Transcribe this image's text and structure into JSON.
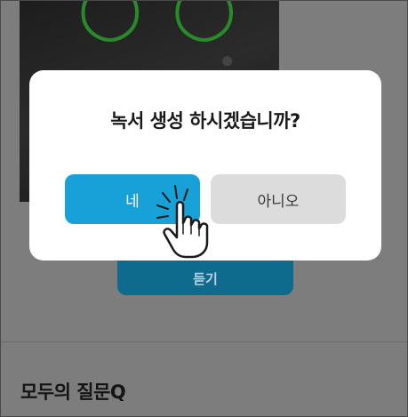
{
  "background": {
    "listen_button_label": "듣기",
    "section_title": "모두의 질문Q"
  },
  "dialog": {
    "title": "녹서 생성 하시겠습니까?",
    "confirm_label": "네",
    "cancel_label": "아니오"
  },
  "colors": {
    "confirm_button": "#18a0d8",
    "cancel_button": "#dcdcdc",
    "listen_button": "#0f6b8e"
  },
  "icons": [
    "tap-hand-icon"
  ]
}
